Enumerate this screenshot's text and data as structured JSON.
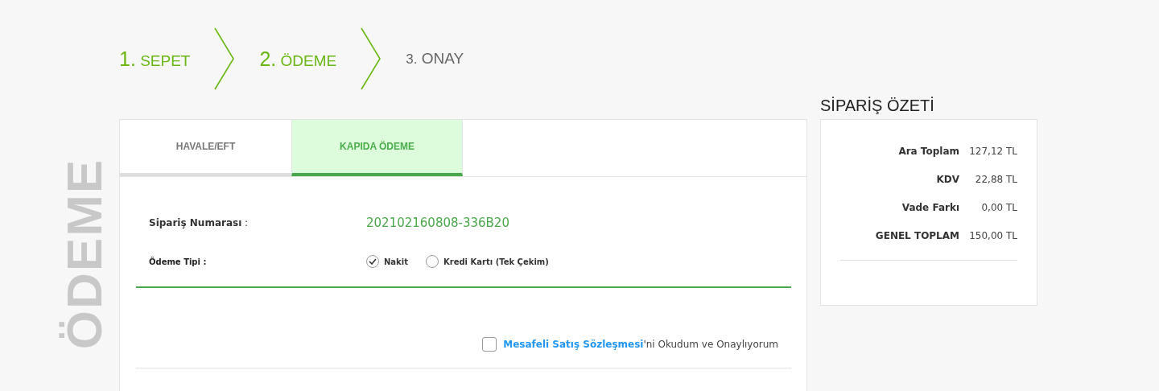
{
  "side_label": "ÖDEME",
  "steps": [
    {
      "number": "1.",
      "label": "SEPET",
      "done": true
    },
    {
      "number": "2.",
      "label": "ÖDEME",
      "done": true
    },
    {
      "number": "3.",
      "label": "ONAY",
      "done": false
    }
  ],
  "tabs": [
    {
      "label": "HAVALE/EFT",
      "selected": false
    },
    {
      "label": "KAPIDA ÖDEME",
      "selected": true
    }
  ],
  "order_number": {
    "label": "Sipariş Numarası",
    "sep": ":",
    "value": "202102160808-336B20"
  },
  "payment_type": {
    "label": "Ödeme Tipi :",
    "options": [
      {
        "label": "Nakit",
        "selected": true
      },
      {
        "label": "Kredi Kartı (Tek Çekim)",
        "selected": false
      }
    ]
  },
  "agreement": {
    "checked": false,
    "link": "Mesafeli Satış Sözleşmesi",
    "text": "'ni Okudum ve Onaylıyorum"
  },
  "summary": {
    "title": "SİPARİŞ ÖZETİ",
    "rows": [
      {
        "label": "Ara Toplam",
        "value": "127,12 TL"
      },
      {
        "label": "KDV",
        "value": "22,88 TL"
      },
      {
        "label": "Vade Farkı",
        "value": "0,00 TL"
      },
      {
        "label": "GENEL TOPLAM",
        "value": "150,00 TL"
      }
    ]
  }
}
